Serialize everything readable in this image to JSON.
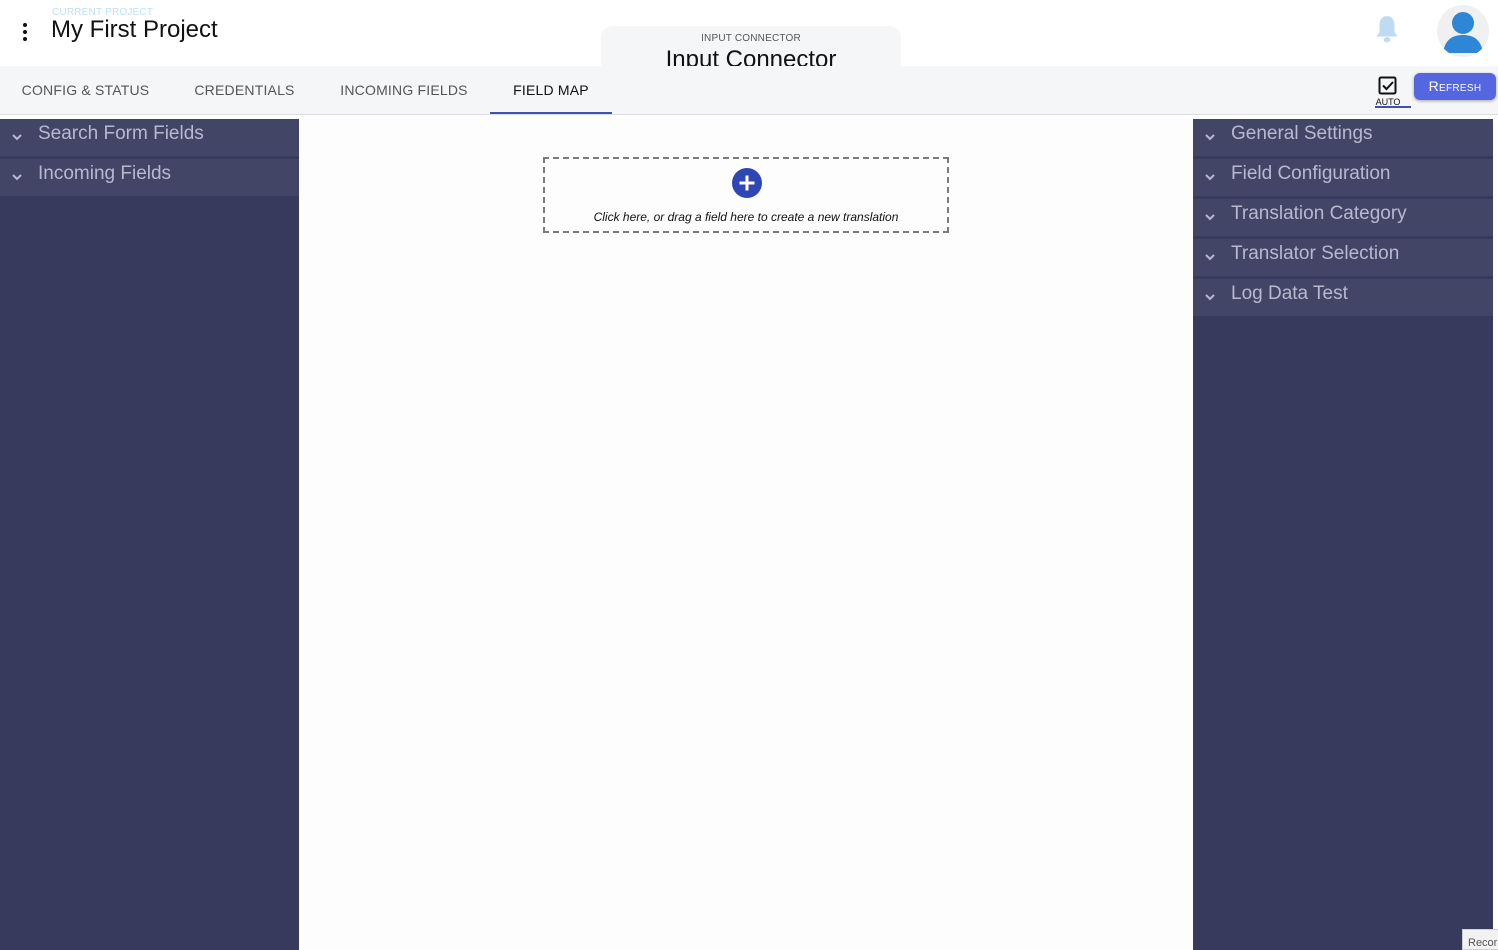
{
  "header": {
    "project_caption": "CURRENT PROJECT",
    "project_name": "My First Project",
    "connector_caption": "INPUT CONNECTOR",
    "connector_name": "Input Connector",
    "icons": [
      "more-vert-icon",
      "bell-icon",
      "user-avatar-icon"
    ]
  },
  "tabs": [
    {
      "label": "CONFIG & STATUS",
      "active": false
    },
    {
      "label": "CREDENTIALS",
      "active": false
    },
    {
      "label": "INCOMING FIELDS",
      "active": false
    },
    {
      "label": "FIELD MAP",
      "active": true
    }
  ],
  "toolbar": {
    "auto_label": "AUTO",
    "auto_checked": true,
    "refresh_label": "Refresh"
  },
  "left_panel": {
    "items": [
      {
        "label": "Search Form Fields"
      },
      {
        "label": "Incoming Fields"
      }
    ]
  },
  "right_panel": {
    "items": [
      {
        "label": "General Settings"
      },
      {
        "label": "Field Configuration"
      },
      {
        "label": "Translation Category"
      },
      {
        "label": "Translator Selection"
      },
      {
        "label": "Log Data Test"
      }
    ]
  },
  "main": {
    "dropzone_text": "Click here, or drag a field here to create a new translation"
  },
  "corner": {
    "label": "Recor"
  },
  "colors": {
    "sidebar": "#37395d",
    "accordion_header": "#434567",
    "accent": "#3f51b5",
    "refresh_button": "#5567e0",
    "avatar": "#2f86d6"
  }
}
